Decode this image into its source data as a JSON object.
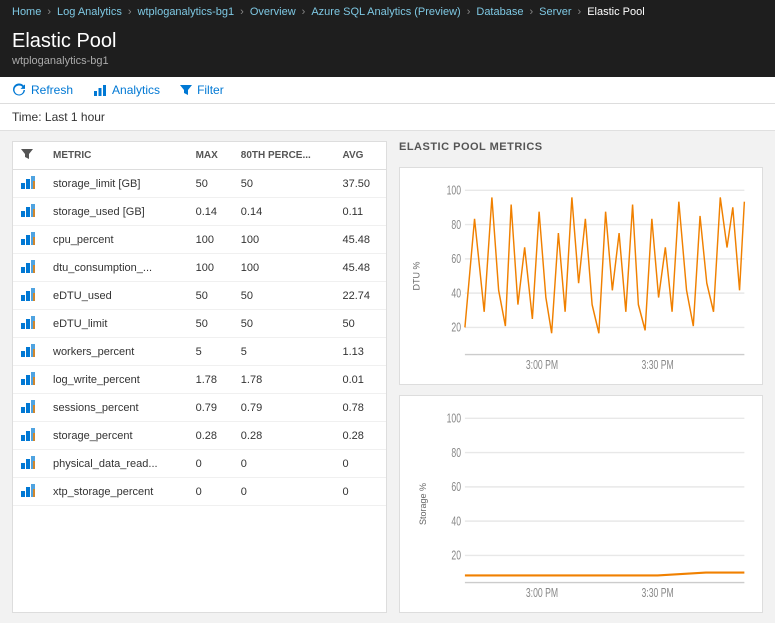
{
  "breadcrumb": {
    "items": [
      "Home",
      "Log Analytics",
      "wtploganalytics-bg1",
      "Overview",
      "Azure SQL Analytics (Preview)",
      "Database",
      "Server",
      "Elastic Pool"
    ]
  },
  "title": "Elastic Pool",
  "subtitle": "wtploganalytics-bg1",
  "toolbar": {
    "refresh_label": "Refresh",
    "analytics_label": "Analytics",
    "filter_label": "Filter"
  },
  "time_filter": "Time: Last 1 hour",
  "table": {
    "headers": [
      "",
      "METRIC",
      "MAX",
      "80TH PERCE...",
      "AVG"
    ],
    "rows": [
      [
        "bar",
        "storage_limit [GB]",
        "50",
        "50",
        "37.50"
      ],
      [
        "bar",
        "storage_used [GB]",
        "0.14",
        "0.14",
        "0.11"
      ],
      [
        "bar",
        "cpu_percent",
        "100",
        "100",
        "45.48"
      ],
      [
        "bar",
        "dtu_consumption_...",
        "100",
        "100",
        "45.48"
      ],
      [
        "bar",
        "eDTU_used",
        "50",
        "50",
        "22.74"
      ],
      [
        "bar",
        "eDTU_limit",
        "50",
        "50",
        "50"
      ],
      [
        "bar",
        "workers_percent",
        "5",
        "5",
        "1.13"
      ],
      [
        "bar",
        "log_write_percent",
        "1.78",
        "1.78",
        "0.01"
      ],
      [
        "bar",
        "sessions_percent",
        "0.79",
        "0.79",
        "0.78"
      ],
      [
        "bar",
        "storage_percent",
        "0.28",
        "0.28",
        "0.28"
      ],
      [
        "bar",
        "physical_data_read...",
        "0",
        "0",
        "0"
      ],
      [
        "bar",
        "xtp_storage_percent",
        "0",
        "0",
        "0"
      ]
    ]
  },
  "charts": {
    "section_title": "ELASTIC POOL METRICS",
    "chart1": {
      "y_label": "DTU %",
      "y_ticks": [
        "100",
        "80",
        "60",
        "40",
        "20"
      ],
      "x_ticks": [
        "3:00 PM",
        "3:30 PM"
      ],
      "color": "#f08000"
    },
    "chart2": {
      "y_label": "Storage %",
      "y_ticks": [
        "100",
        "80",
        "60",
        "40",
        "20"
      ],
      "x_ticks": [
        "3:00 PM",
        "3:30 PM"
      ],
      "color": "#f08000"
    }
  }
}
